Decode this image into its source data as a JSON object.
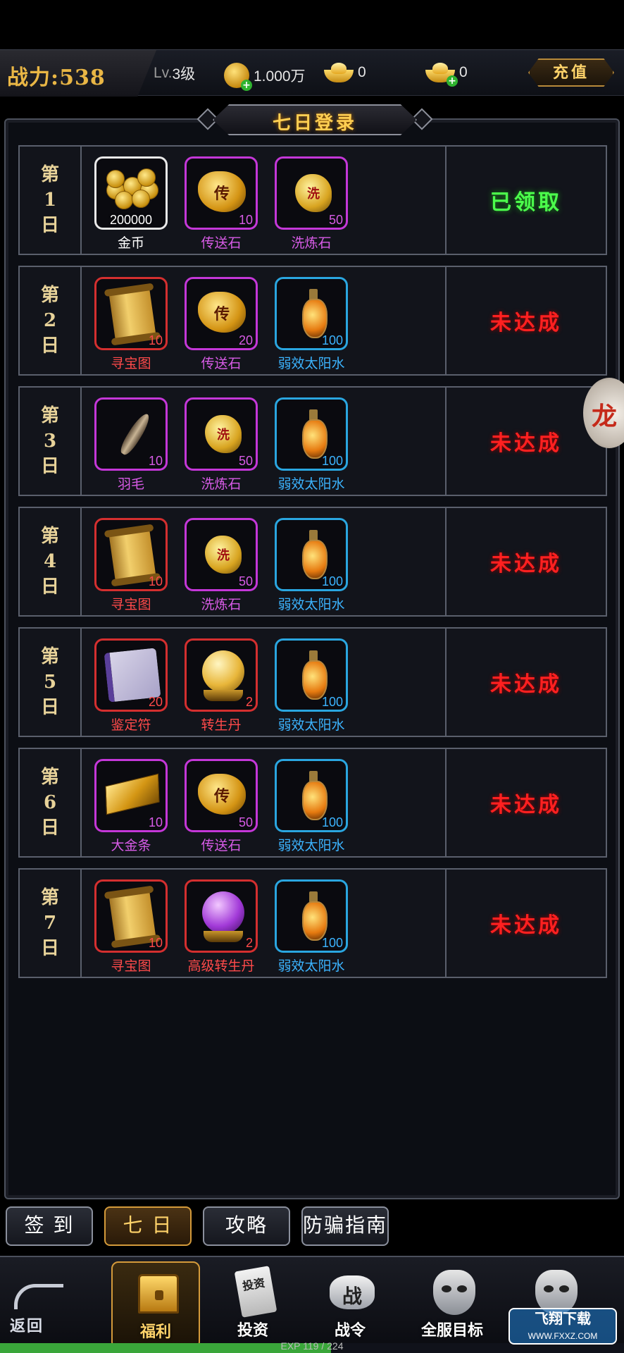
{
  "topbar": {
    "power_label": "战力:538",
    "level_prefix": "Lv.",
    "level_value": "3级",
    "coins": "1.000万",
    "ingot_bound": "0",
    "ingot": "0",
    "recharge": "充值"
  },
  "panel": {
    "title": "七日登录"
  },
  "days": [
    {
      "day": [
        "第",
        "1",
        "日"
      ],
      "status": "已领取",
      "status_kind": "claimed",
      "items": [
        {
          "name": "金币",
          "qty": "200000",
          "rarity": "white",
          "art": "coins"
        },
        {
          "name": "传送石",
          "qty": "10",
          "rarity": "purple",
          "art": "gold-rock"
        },
        {
          "name": "洗炼石",
          "qty": "50",
          "rarity": "purple",
          "art": "wash-rock"
        }
      ]
    },
    {
      "day": [
        "第",
        "2",
        "日"
      ],
      "status": "未达成",
      "status_kind": "pending",
      "items": [
        {
          "name": "寻宝图",
          "qty": "10",
          "rarity": "red",
          "art": "scroll"
        },
        {
          "name": "传送石",
          "qty": "20",
          "rarity": "purple",
          "art": "gold-rock"
        },
        {
          "name": "弱效太阳水",
          "qty": "100",
          "rarity": "blue",
          "art": "potion"
        }
      ]
    },
    {
      "day": [
        "第",
        "3",
        "日"
      ],
      "status": "未达成",
      "status_kind": "pending",
      "items": [
        {
          "name": "羽毛",
          "qty": "10",
          "rarity": "purple",
          "art": "feather"
        },
        {
          "name": "洗炼石",
          "qty": "50",
          "rarity": "purple",
          "art": "wash-rock"
        },
        {
          "name": "弱效太阳水",
          "qty": "100",
          "rarity": "blue",
          "art": "potion"
        }
      ]
    },
    {
      "day": [
        "第",
        "4",
        "日"
      ],
      "status": "未达成",
      "status_kind": "pending",
      "items": [
        {
          "name": "寻宝图",
          "qty": "10",
          "rarity": "red",
          "art": "scroll"
        },
        {
          "name": "洗炼石",
          "qty": "50",
          "rarity": "purple",
          "art": "wash-rock"
        },
        {
          "name": "弱效太阳水",
          "qty": "100",
          "rarity": "blue",
          "art": "potion"
        }
      ]
    },
    {
      "day": [
        "第",
        "5",
        "日"
      ],
      "status": "未达成",
      "status_kind": "pending",
      "items": [
        {
          "name": "鉴定符",
          "qty": "20",
          "rarity": "red",
          "art": "parchment"
        },
        {
          "name": "转生丹",
          "qty": "2",
          "rarity": "red",
          "art": "orb"
        },
        {
          "name": "弱效太阳水",
          "qty": "100",
          "rarity": "blue",
          "art": "potion"
        }
      ]
    },
    {
      "day": [
        "第",
        "6",
        "日"
      ],
      "status": "未达成",
      "status_kind": "pending",
      "items": [
        {
          "name": "大金条",
          "qty": "10",
          "rarity": "purple",
          "art": "bar"
        },
        {
          "name": "传送石",
          "qty": "50",
          "rarity": "purple",
          "art": "gold-rock"
        },
        {
          "name": "弱效太阳水",
          "qty": "100",
          "rarity": "blue",
          "art": "potion"
        }
      ]
    },
    {
      "day": [
        "第",
        "7",
        "日"
      ],
      "status": "未达成",
      "status_kind": "pending",
      "items": [
        {
          "name": "寻宝图",
          "qty": "10",
          "rarity": "red",
          "art": "scroll"
        },
        {
          "name": "高级转生丹",
          "qty": "2",
          "rarity": "red",
          "art": "orb-purple"
        },
        {
          "name": "弱效太阳水",
          "qty": "100",
          "rarity": "blue",
          "art": "potion"
        }
      ]
    }
  ],
  "rock_glyphs": {
    "gold-rock": "传",
    "wash-rock": "洗"
  },
  "tabs": [
    {
      "label": "签 到",
      "active": false
    },
    {
      "label": "七 日",
      "active": true
    },
    {
      "label": "攻略",
      "active": false
    },
    {
      "label": "防骗指南",
      "active": false
    }
  ],
  "nav": {
    "back": "返回",
    "items": [
      {
        "label": "福利",
        "icon": "treasure-chest-icon",
        "active": true
      },
      {
        "label": "投资",
        "icon": "investment-scroll-icon",
        "active": false,
        "glyph": "投资"
      },
      {
        "label": "战令",
        "icon": "battle-pass-icon",
        "active": false,
        "glyph": "战"
      },
      {
        "label": "全服目标",
        "icon": "server-goal-icon",
        "active": false
      },
      {
        "label": "",
        "icon": "demon-mask-icon",
        "active": false
      }
    ]
  },
  "exp": {
    "label": "EXP",
    "text": "119 / 224",
    "fraction": 0.53
  },
  "watermark": {
    "title": "飞翔下载",
    "url": "WWW.FXXZ.COM"
  },
  "colors": {
    "gold": "#ffcf52",
    "claimed": "#4cff4c",
    "pending": "#ff2020"
  }
}
